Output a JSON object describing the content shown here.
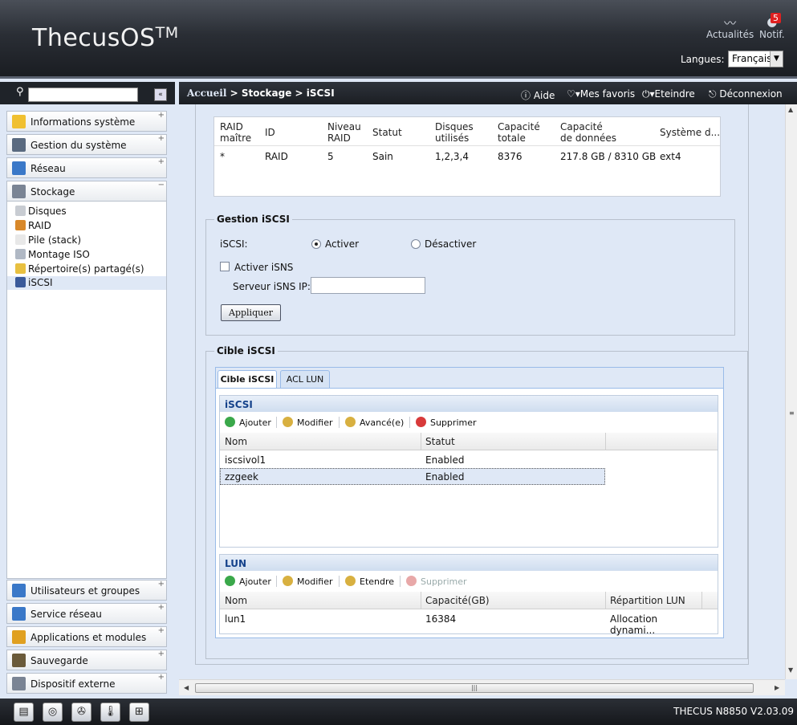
{
  "header": {
    "logo": "ThecusOS",
    "logo_tm": "TM",
    "news_label": "Actualités",
    "notif_label": "Notif.",
    "notif_count": "5",
    "lang_label": "Langues:",
    "lang_value": "Français"
  },
  "topbar": {
    "breadcrumb_home": "Accueil",
    "breadcrumb_rest": " > Stockage > iSCSI",
    "help": "Aide",
    "favorites": "Mes favoris",
    "shutdown": "Eteindre",
    "logout": "Déconnexion"
  },
  "sidebar": {
    "panels_top": [
      {
        "label": "Informations système",
        "color": "#f0c030"
      },
      {
        "label": "Gestion du système",
        "color": "#5a6a80"
      },
      {
        "label": "Réseau",
        "color": "#3a78c8"
      },
      {
        "label": "Stockage",
        "color": "#7a8494"
      }
    ],
    "storage_items": [
      "Disques",
      "RAID",
      "Pile (stack)",
      "Montage ISO",
      "Répertoire(s) partagé(s)",
      "iSCSI"
    ],
    "panels_bottom": [
      {
        "label": "Utilisateurs et groupes",
        "color": "#3a78c8"
      },
      {
        "label": "Service réseau",
        "color": "#3a78c8"
      },
      {
        "label": "Applications et modules",
        "color": "#e0a020"
      },
      {
        "label": "Sauvegarde",
        "color": "#6a5a3a"
      },
      {
        "label": "Dispositif externe",
        "color": "#7a8494"
      }
    ]
  },
  "raid": {
    "headers": [
      [
        "RAID",
        "maître"
      ],
      [
        "ID",
        ""
      ],
      [
        "Niveau",
        "RAID"
      ],
      [
        "Statut",
        ""
      ],
      [
        "Disques",
        "utilisés"
      ],
      [
        "Capacité",
        "totale"
      ],
      [
        "Capacité",
        "de données"
      ],
      [
        "Système d...",
        ""
      ]
    ],
    "row": [
      "*",
      "RAID",
      "5",
      "Sain",
      "1,2,3,4",
      "8376",
      "217.8 GB / 8310 GB",
      "ext4"
    ]
  },
  "gestion": {
    "legend": "Gestion iSCSI",
    "iscsi_label": "iSCSI:",
    "enable": "Activer",
    "disable": "Désactiver",
    "isns_label": "Activer iSNS",
    "isns_ip_label": "Serveur iSNS IP:",
    "isns_ip_value": "",
    "apply": "Appliquer"
  },
  "cible": {
    "legend": "Cible iSCSI",
    "tabs": [
      "Cible iSCSI",
      "ACL LUN"
    ],
    "iscsi_panel": {
      "title": "iSCSI",
      "toolbar": [
        "Ajouter",
        "Modifier",
        "Avancé(e)",
        "Supprimer"
      ],
      "columns": [
        "Nom",
        "Statut"
      ],
      "rows": [
        [
          "iscsivol1",
          "Enabled"
        ],
        [
          "zzgeek",
          "Enabled"
        ]
      ]
    },
    "lun_panel": {
      "title": "LUN",
      "toolbar": [
        "Ajouter",
        "Modifier",
        "Etendre",
        "Supprimer"
      ],
      "columns": [
        "Nom",
        "Capacité(GB)",
        "Répartition LUN"
      ],
      "rows": [
        [
          "lun1",
          "16384",
          "Allocation dynami..."
        ]
      ]
    }
  },
  "footer": {
    "version": "THECUS N8850 V2.03.09"
  }
}
